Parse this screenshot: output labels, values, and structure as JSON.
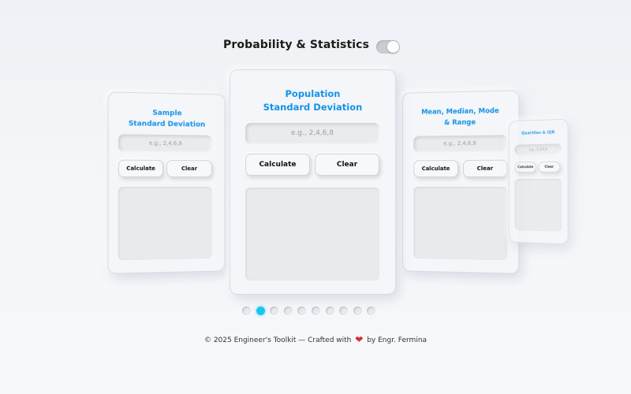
{
  "header": {
    "title": "Probability & Statistics",
    "toggle_state": "on"
  },
  "cards": [
    {
      "title": "Sample\nStandard Deviation",
      "input_placeholder": "e.g., 2,4,6,8",
      "calculate_label": "Calculate",
      "clear_label": "Clear"
    },
    {
      "title": "Population\nStandard Deviation",
      "input_placeholder": "e.g., 2,4,6,8",
      "calculate_label": "Calculate",
      "clear_label": "Clear"
    },
    {
      "title": "Mean, Median, Mode\n& Range",
      "input_placeholder": "e.g., 2,4,6,8",
      "calculate_label": "Calculate",
      "clear_label": "Clear"
    },
    {
      "title": "Quartiles & IQR",
      "input_placeholder": "e.g., 2,4,6,8",
      "calculate_label": "Calculate",
      "clear_label": "Clear"
    }
  ],
  "pager": {
    "total": 10,
    "active_index": 1
  },
  "footer": {
    "prefix": "© 2025 Engineer's Toolkit — Crafted with",
    "suffix": "by Engr. Fermina"
  },
  "colors": {
    "title_accent": "#1593e8",
    "active_dot": "#18c8f0",
    "heart": "#d62b3b"
  }
}
